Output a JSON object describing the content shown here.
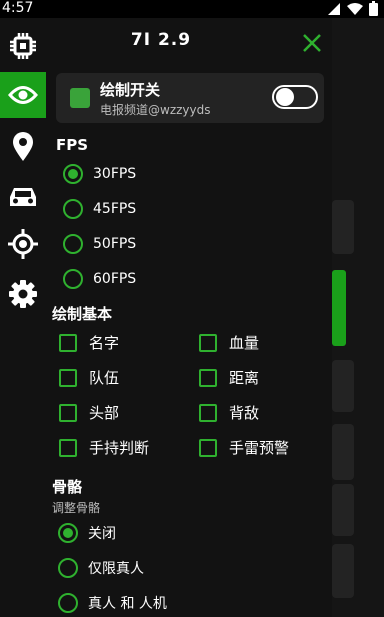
{
  "status": {
    "time": "4:57"
  },
  "header": {
    "title": "7I 2.9"
  },
  "sidebar": {
    "items": [
      {
        "icon": "chip-icon",
        "active": false
      },
      {
        "icon": "eye-icon",
        "active": true
      },
      {
        "icon": "location-pin-icon",
        "active": false
      },
      {
        "icon": "car-icon",
        "active": false
      },
      {
        "icon": "crosshair-icon",
        "active": false
      },
      {
        "icon": "gear-icon",
        "active": false
      }
    ]
  },
  "draw_switch": {
    "title": "绘制开关",
    "subtitle": "电报频道@wzzyyds",
    "enabled": false
  },
  "fps": {
    "heading": "FPS",
    "options": [
      "30FPS",
      "45FPS",
      "50FPS",
      "60FPS"
    ],
    "selected": "30FPS"
  },
  "basic": {
    "heading": "绘制基本",
    "left": [
      "名字",
      "队伍",
      "头部",
      "手持判断"
    ],
    "right": [
      "血量",
      "距离",
      "背敌",
      "手雷预警"
    ]
  },
  "skeleton": {
    "heading": "骨骼",
    "subheading": "调整骨骼",
    "options": [
      "关闭",
      "仅限真人",
      "真人 和 人机"
    ],
    "selected": "关闭"
  },
  "colors": {
    "accent": "#2fb12f",
    "active_rail": "#1aa01a",
    "panel": "#121212",
    "card": "#232323"
  }
}
